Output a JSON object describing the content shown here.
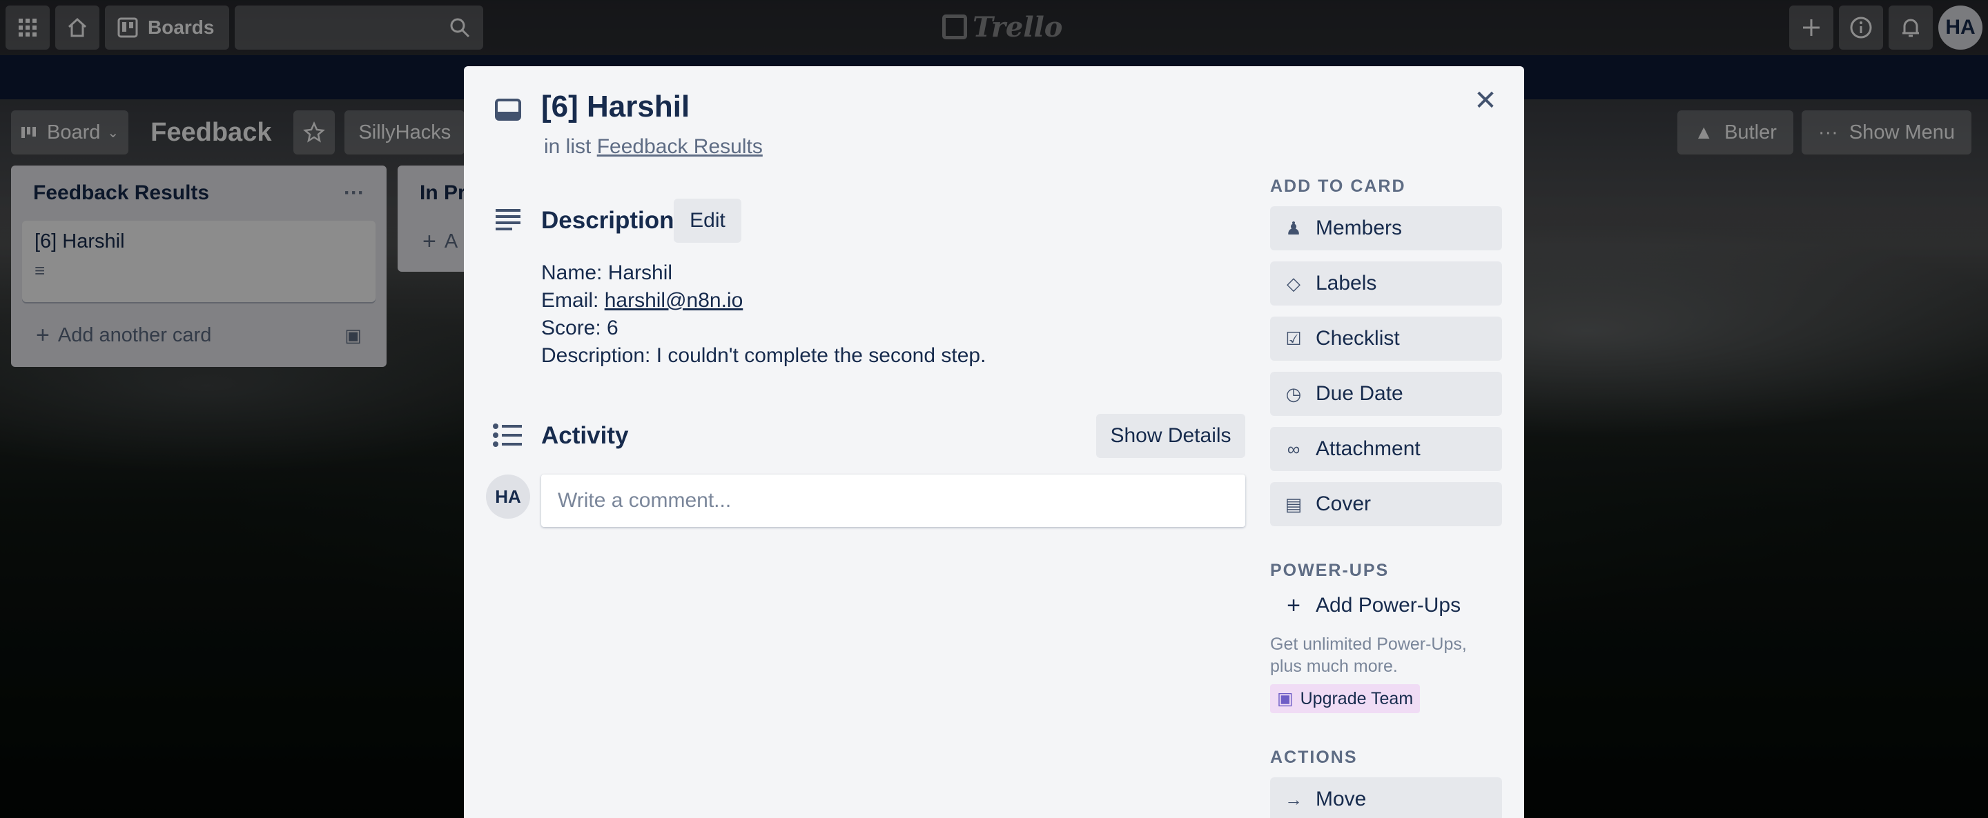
{
  "topbar": {
    "boards_label": "Boards",
    "logo_text": "Trello",
    "user_initials": "HA"
  },
  "board": {
    "view_label": "Board",
    "title": "Feedback",
    "team_label": "SillyHacks",
    "butler_label": "Butler",
    "show_menu_label": "Show Menu"
  },
  "lists": [
    {
      "title": "Feedback Results",
      "cards": [
        {
          "title": "[6] Harshil"
        }
      ],
      "add_card_label": "Add another card"
    },
    {
      "title": "In Pr",
      "add_card_label": "A"
    }
  ],
  "card_modal": {
    "title": "[6] Harshil",
    "in_list_prefix": "in list",
    "list_name": "Feedback Results",
    "description": {
      "heading": "Description",
      "edit_label": "Edit",
      "name_line": "Name: Harshil",
      "email_prefix": "Email:",
      "email": "harshil@n8n.io",
      "score_line": "Score: 6",
      "description_line": "Description: I couldn't complete the second step."
    },
    "activity": {
      "heading": "Activity",
      "show_details_label": "Show Details",
      "comment_placeholder": "Write a comment...",
      "avatar_initials": "HA"
    },
    "sidebar": {
      "add_to_card_heading": "ADD TO CARD",
      "add_to_card": [
        {
          "label": "Members",
          "icon": "person-icon"
        },
        {
          "label": "Labels",
          "icon": "tag-icon"
        },
        {
          "label": "Checklist",
          "icon": "checklist-icon"
        },
        {
          "label": "Due Date",
          "icon": "clock-icon"
        },
        {
          "label": "Attachment",
          "icon": "paperclip-icon"
        },
        {
          "label": "Cover",
          "icon": "cover-icon"
        }
      ],
      "power_ups_heading": "POWER-UPS",
      "add_power_ups_label": "Add Power-Ups",
      "power_ups_note_line1": "Get unlimited Power-Ups,",
      "power_ups_note_line2": "plus much more.",
      "upgrade_label": "Upgrade Team",
      "actions_heading": "ACTIONS",
      "move_label": "Move"
    }
  }
}
